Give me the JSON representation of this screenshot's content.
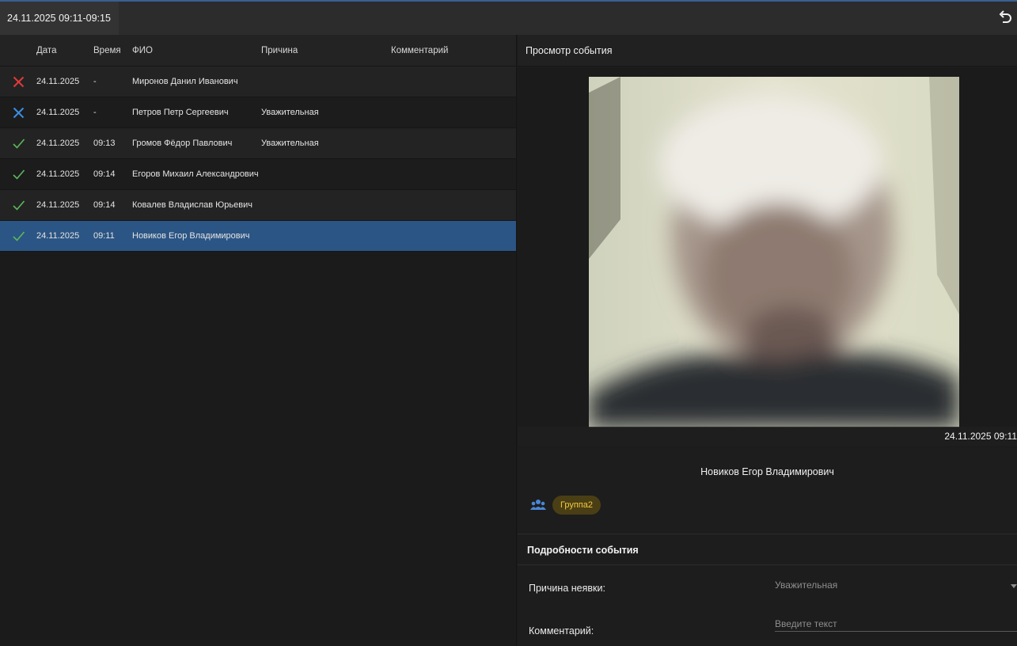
{
  "window": {
    "title": "24.11.2025 09:11-09:15",
    "back_icon": "undo-icon"
  },
  "table": {
    "columns": [
      "Дата",
      "Время",
      "ФИО",
      "Причина",
      "Комментарий"
    ],
    "rows": [
      {
        "status": "absent",
        "status_icon": "red-x-icon",
        "color": "#e03a3a",
        "date": "24.11.2025",
        "time": "-",
        "name": "Миронов Данил Иванович",
        "reason": "",
        "comment": ""
      },
      {
        "status": "excused",
        "status_icon": "blue-x-icon",
        "color": "#3c8de0",
        "date": "24.11.2025",
        "time": "-",
        "name": "Петров Петр Сергеевич",
        "reason": "Уважительная",
        "comment": ""
      },
      {
        "status": "present",
        "status_icon": "green-check-icon",
        "color": "#5cb85c",
        "date": "24.11.2025",
        "time": "09:13",
        "name": "Громов Фёдор Павлович",
        "reason": "Уважительная",
        "comment": ""
      },
      {
        "status": "present",
        "status_icon": "green-check-icon",
        "color": "#5cb85c",
        "date": "24.11.2025",
        "time": "09:14",
        "name": "Егоров Михаил Александрович",
        "reason": "",
        "comment": ""
      },
      {
        "status": "present",
        "status_icon": "green-check-icon",
        "color": "#5cb85c",
        "date": "24.11.2025",
        "time": "09:14",
        "name": "Ковалев Владислав Юрьевич",
        "reason": "",
        "comment": ""
      },
      {
        "status": "present",
        "status_icon": "green-check-icon",
        "color": "#5cb85c",
        "date": "24.11.2025",
        "time": "09:11",
        "name": "Новиков Егор Владимирович",
        "reason": "",
        "comment": "",
        "selected": true
      }
    ]
  },
  "event_view": {
    "title": "Просмотр события",
    "timestamp": "24.11.2025 09:11",
    "person_name": "Новиков Егор Владимирович",
    "group_icon": "group-icon",
    "group": "Группа2"
  },
  "details": {
    "title": "Подробности события",
    "reason_label": "Причина неявки:",
    "reason_value": "Уважительная",
    "comment_label": "Комментарий:",
    "comment_placeholder": "Введите текст",
    "comment_value": ""
  },
  "colors": {
    "selected_row": "#2b5584",
    "group_chip_text": "#f4c842",
    "accent": "#3a5f92"
  }
}
